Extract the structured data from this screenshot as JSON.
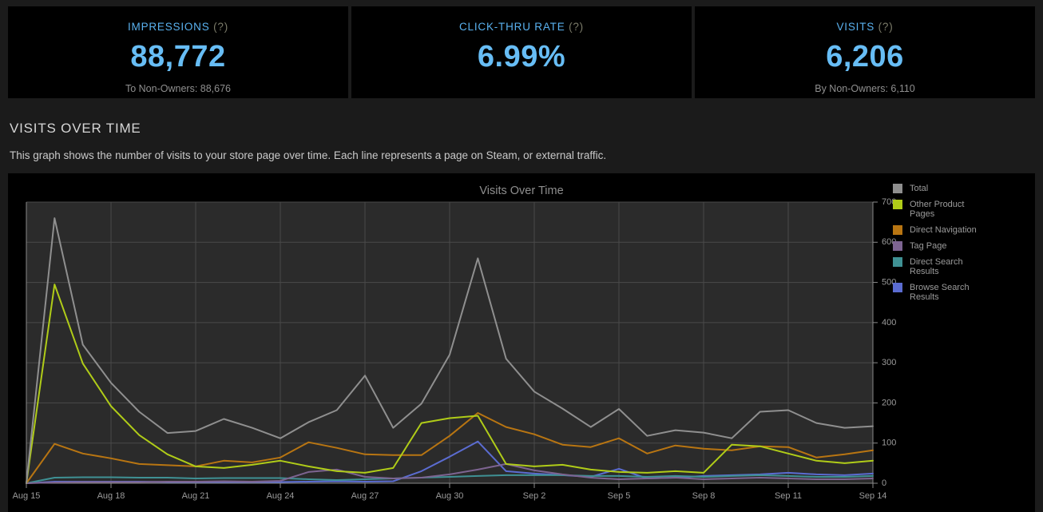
{
  "stats": [
    {
      "label": "IMPRESSIONS",
      "help": "(?)",
      "value": "88,772",
      "sub": "To Non-Owners: 88,676"
    },
    {
      "label": "CLICK-THRU RATE",
      "help": "(?)",
      "value": "6.99%",
      "sub": ""
    },
    {
      "label": "VISITS",
      "help": "(?)",
      "value": "6,206",
      "sub": "By Non-Owners: 6,110"
    }
  ],
  "section": {
    "title": "VISITS OVER TIME",
    "description": "This graph shows the number of visits to your store page over time. Each line represents a page on Steam, or external traffic."
  },
  "chart_data": {
    "type": "line",
    "title": "Visits Over Time",
    "xlabel": "",
    "ylabel": "",
    "ylim": [
      0,
      700
    ],
    "yticks": [
      0,
      100,
      200,
      300,
      400,
      500,
      600,
      700
    ],
    "grid": true,
    "legend_position": "right",
    "x": [
      "Aug 15",
      "Aug 16",
      "Aug 17",
      "Aug 18",
      "Aug 19",
      "Aug 20",
      "Aug 21",
      "Aug 22",
      "Aug 23",
      "Aug 24",
      "Aug 25",
      "Aug 26",
      "Aug 27",
      "Aug 28",
      "Aug 29",
      "Aug 30",
      "Aug 31",
      "Sep 1",
      "Sep 2",
      "Sep 3",
      "Sep 4",
      "Sep 5",
      "Sep 6",
      "Sep 7",
      "Sep 8",
      "Sep 9",
      "Sep 10",
      "Sep 11",
      "Sep 12",
      "Sep 13",
      "Sep 14"
    ],
    "xtick_labels": [
      "Aug 15",
      "Aug 18",
      "Aug 21",
      "Aug 24",
      "Aug 27",
      "Aug 30",
      "Sep 2",
      "Sep 5",
      "Sep 8",
      "Sep 11",
      "Sep 14"
    ],
    "xtick_indices": [
      0,
      3,
      6,
      9,
      12,
      15,
      18,
      21,
      24,
      27,
      30
    ],
    "series": [
      {
        "name": "Total",
        "color": "#8f8f8f",
        "values": [
          0,
          660,
          345,
          250,
          178,
          125,
          130,
          160,
          138,
          112,
          152,
          182,
          268,
          138,
          198,
          320,
          560,
          310,
          228,
          186,
          140,
          185,
          118,
          132,
          126,
          112,
          178,
          182,
          150,
          138,
          142
        ]
      },
      {
        "name": "Other Product Pages",
        "color": "#b0cc18",
        "values": [
          0,
          495,
          298,
          192,
          120,
          72,
          42,
          38,
          46,
          56,
          42,
          30,
          26,
          38,
          150,
          162,
          168,
          48,
          42,
          46,
          34,
          28,
          26,
          30,
          26,
          96,
          92,
          74,
          56,
          50,
          56
        ]
      },
      {
        "name": "Direct Navigation",
        "color": "#b87512",
        "values": [
          0,
          98,
          74,
          62,
          48,
          45,
          42,
          56,
          52,
          64,
          102,
          88,
          72,
          70,
          70,
          118,
          175,
          140,
          122,
          96,
          90,
          112,
          74,
          94,
          86,
          82,
          92,
          90,
          64,
          72,
          82
        ]
      },
      {
        "name": "Tag Page",
        "color": "#7d6491",
        "values": [
          0,
          2,
          3,
          3,
          3,
          4,
          4,
          5,
          4,
          6,
          28,
          34,
          16,
          12,
          14,
          22,
          34,
          48,
          32,
          22,
          14,
          10,
          12,
          14,
          10,
          12,
          14,
          12,
          10,
          10,
          12
        ]
      },
      {
        "name": "Direct Search Results",
        "color": "#3f9194",
        "values": [
          0,
          14,
          15,
          15,
          14,
          14,
          12,
          13,
          13,
          13,
          10,
          8,
          10,
          12,
          14,
          16,
          18,
          20,
          20,
          20,
          18,
          18,
          16,
          18,
          16,
          18,
          20,
          18,
          16,
          16,
          18
        ]
      },
      {
        "name": "Browse Search Results",
        "color": "#5b6cd1",
        "values": [
          0,
          4,
          4,
          4,
          4,
          3,
          3,
          3,
          3,
          3,
          4,
          5,
          4,
          5,
          30,
          66,
          104,
          30,
          24,
          20,
          16,
          36,
          12,
          14,
          18,
          20,
          22,
          26,
          22,
          20,
          24
        ]
      }
    ]
  }
}
